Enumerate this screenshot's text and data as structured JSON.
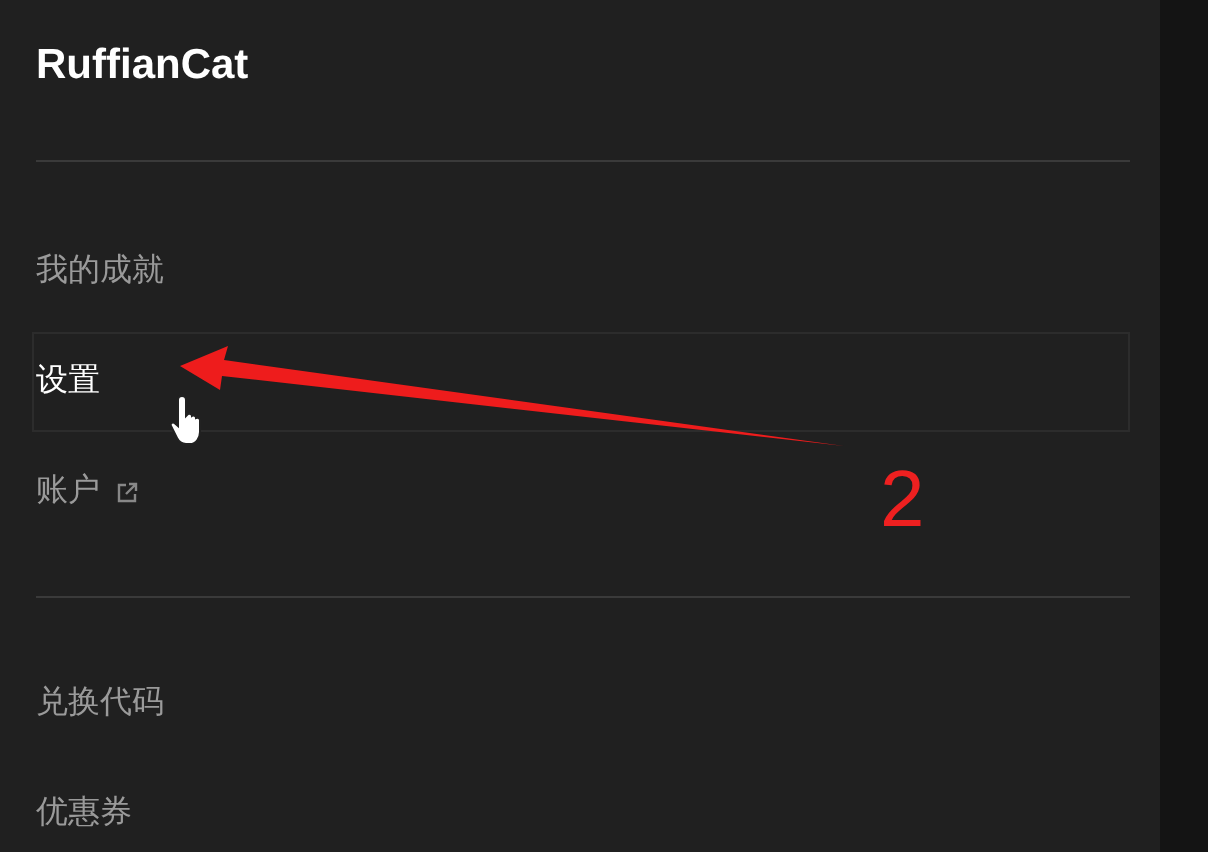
{
  "user": {
    "name": "RuffianCat"
  },
  "sections": [
    {
      "items": [
        {
          "label": "我的成就",
          "selected": false,
          "external": false
        },
        {
          "label": "设置",
          "selected": true,
          "external": false
        },
        {
          "label": "账户",
          "selected": false,
          "external": true
        }
      ]
    },
    {
      "items": [
        {
          "label": "兑换代码",
          "selected": false,
          "external": false
        },
        {
          "label": "优惠券",
          "selected": false,
          "external": false
        }
      ]
    }
  ],
  "annotation": {
    "label": "2"
  }
}
